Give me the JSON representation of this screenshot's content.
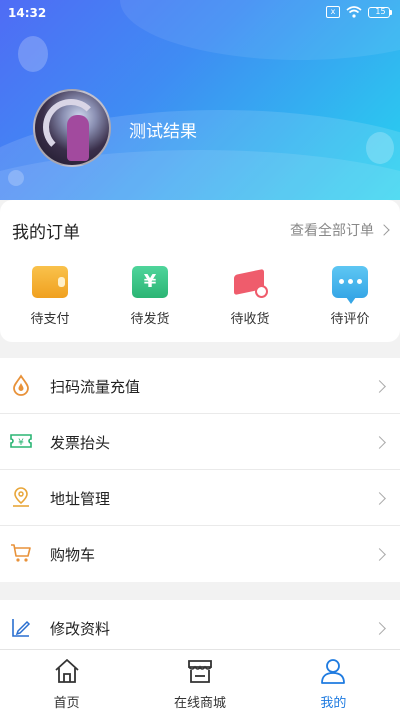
{
  "status_bar": {
    "time": "14:32",
    "battery": "15",
    "sim_label": "x"
  },
  "profile": {
    "username": "测试结果"
  },
  "orders": {
    "title": "我的订单",
    "view_all": "查看全部订单",
    "items": [
      {
        "label": "待支付",
        "icon": "wallet-icon"
      },
      {
        "label": "待发货",
        "icon": "yuan-ticket-icon",
        "glyph": "¥"
      },
      {
        "label": "待收货",
        "icon": "package-icon"
      },
      {
        "label": "待评价",
        "icon": "chat-bubble-icon"
      }
    ]
  },
  "menu": {
    "items": [
      {
        "label": "扫码流量充值",
        "icon": "drop-icon"
      },
      {
        "label": "发票抬头",
        "icon": "invoice-icon"
      },
      {
        "label": "地址管理",
        "icon": "location-pin-icon"
      },
      {
        "label": "购物车",
        "icon": "cart-icon"
      }
    ],
    "extra": {
      "label": "修改资料",
      "icon": "edit-icon"
    }
  },
  "bottom_nav": {
    "items": [
      {
        "label": "首页",
        "icon": "home-icon"
      },
      {
        "label": "在线商城",
        "icon": "store-icon"
      },
      {
        "label": "我的",
        "icon": "user-icon"
      }
    ],
    "active_index": 2
  },
  "colors": {
    "accent": "#1f7be0",
    "header_gradient_start": "#4f6cf5",
    "header_gradient_end": "#27d3ef",
    "icon_orange": "#e8923a",
    "icon_green": "#2bb574"
  }
}
